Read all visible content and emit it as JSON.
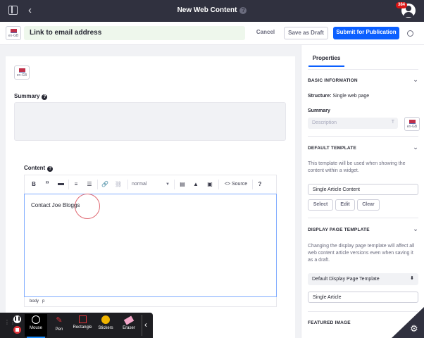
{
  "topbar": {
    "title": "New Web Content",
    "help_glyph": "?",
    "notification_count": "384",
    "back_glyph": "‹"
  },
  "header": {
    "language_code": "en-GB",
    "title_value": "Link to email address",
    "cancel_label": "Cancel",
    "save_draft_label": "Save as Draft",
    "publish_label": "Submit for Publication"
  },
  "main": {
    "language_code": "en-GB",
    "summary_label": "Summary",
    "content_label": "Content",
    "editor": {
      "format_value": "normal",
      "source_label": "Source",
      "help_glyph": "?",
      "text": "Contact Joe Bloggs",
      "path": [
        "body",
        "p"
      ]
    }
  },
  "sidebar": {
    "tab_label": "Properties",
    "basic_info": {
      "heading": "BASIC INFORMATION",
      "structure_label": "Structure:",
      "structure_value": "Single web page",
      "summary_label": "Summary",
      "description_placeholder": "Description",
      "language_code": "en-GB"
    },
    "default_template": {
      "heading": "DEFAULT TEMPLATE",
      "description": "This template will be used when showing the content within a widget.",
      "value": "Single Article Content",
      "select_label": "Select",
      "edit_label": "Edit",
      "clear_label": "Clear"
    },
    "display_page_template": {
      "heading": "DISPLAY PAGE TEMPLATE",
      "description": "Changing the display page template will affect all web content article versions even when saving it as a draft.",
      "select_value": "Default Display Page Template",
      "value": "Single Article"
    },
    "featured_image": {
      "heading": "FEATURED IMAGE"
    }
  },
  "recorder": {
    "tools": [
      "Mouse",
      "Pen",
      "Rectangle",
      "Stickers",
      "Eraser"
    ]
  },
  "colors": {
    "topbar": "#30313f",
    "primary": "#0b5fff",
    "title_bg": "#eef7ec",
    "badge": "#da1414",
    "cursor_ring": "#e06a74"
  },
  "icons": [
    "sidebar-toggle-icon",
    "back-icon",
    "help-icon",
    "user-avatar-icon",
    "gear-icon",
    "flag-icon",
    "bold-icon",
    "quote-icon",
    "hr-icon",
    "ordered-list-icon",
    "unordered-list-icon",
    "link-icon",
    "unlink-icon",
    "table-icon",
    "image-icon",
    "file-icon",
    "code-icon",
    "chevron-down-icon",
    "translate-icon"
  ]
}
